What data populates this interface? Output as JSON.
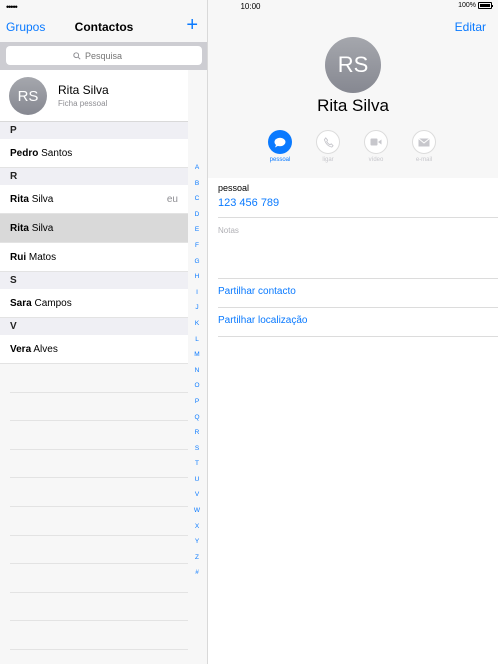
{
  "status": {
    "signal": "•••••",
    "time": "10:00",
    "battery": "100%",
    "battery_level": 1.0
  },
  "left_nav": {
    "groups_label": "Grupos",
    "title": "Contactos",
    "add_icon": "plus-icon"
  },
  "search": {
    "placeholder": "Pesquisa",
    "icon": "search-icon"
  },
  "my_card": {
    "initials": "RS",
    "name": "Rita Silva",
    "subtitle": "Ficha pessoal"
  },
  "sections": [
    {
      "letter": "P",
      "contacts": [
        {
          "first": "Pedro",
          "last": "Santos"
        }
      ]
    },
    {
      "letter": "R",
      "contacts": [
        {
          "first": "Rita",
          "last": "Silva",
          "tag": "eu"
        },
        {
          "first": "Rita",
          "last": "Silva",
          "selected": true
        },
        {
          "first": "Rui",
          "last": "Matos"
        }
      ]
    },
    {
      "letter": "S",
      "contacts": [
        {
          "first": "Sara",
          "last": "Campos"
        }
      ]
    },
    {
      "letter": "V",
      "contacts": [
        {
          "first": "Vera",
          "last": "Alves"
        }
      ]
    }
  ],
  "index_letters": [
    "A",
    "B",
    "C",
    "D",
    "E",
    "F",
    "G",
    "H",
    "I",
    "J",
    "K",
    "L",
    "M",
    "N",
    "O",
    "P",
    "Q",
    "R",
    "S",
    "T",
    "U",
    "V",
    "W",
    "X",
    "Y",
    "Z",
    "#"
  ],
  "detail": {
    "edit_label": "Editar",
    "initials": "RS",
    "name": "Rita Silva",
    "actions": [
      {
        "label": "pessoal",
        "icon": "message-icon",
        "state": "active"
      },
      {
        "label": "ligar",
        "icon": "phone-icon",
        "state": "disabled"
      },
      {
        "label": "vídeo",
        "icon": "video-icon",
        "state": "disabled"
      },
      {
        "label": "e-mail",
        "icon": "mail-icon",
        "state": "disabled"
      }
    ],
    "phone_label": "pessoal",
    "phone_value": "123 456 789",
    "notes_label": "Notas",
    "share_contact": "Partilhar contacto",
    "share_location": "Partilhar localização"
  },
  "colors": {
    "accent": "#0a7aff",
    "avatar": "#9a9ca2",
    "selected_row": "#d9d9d9"
  }
}
